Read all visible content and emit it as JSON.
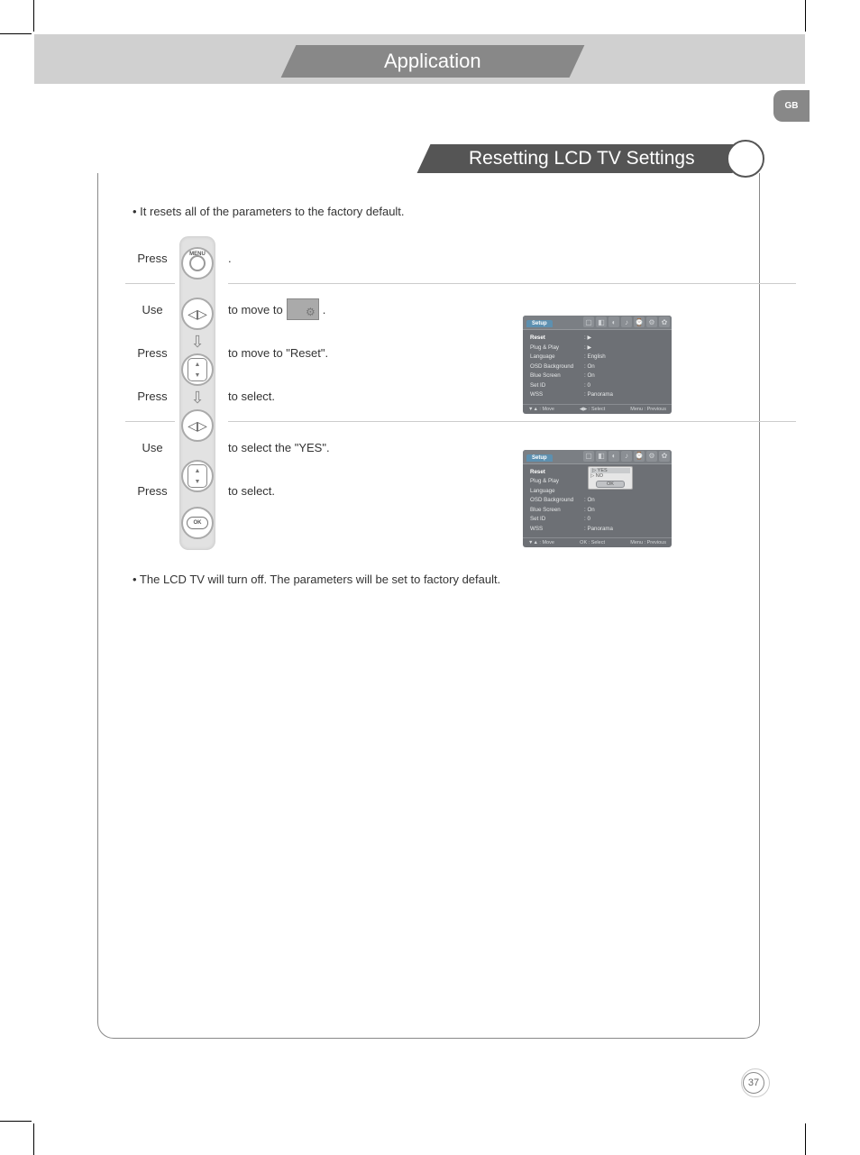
{
  "chapter_title": "Application",
  "language_tab": "GB",
  "section_title": "Resetting LCD TV Settings",
  "intro_bullet": "• It resets all of the parameters to the factory default.",
  "steps": [
    {
      "action": "Press",
      "icon": "menu-button-icon",
      "desc_prefix": "",
      "desc_suffix": "."
    },
    {
      "action": "Use",
      "icon": "left-right-button-icon",
      "desc_prefix": "to move to ",
      "desc_suffix": " ."
    },
    {
      "action": "Press",
      "icon": "down-arrow-button-icon",
      "desc_prefix": "to move to  \"Reset\".",
      "desc_suffix": ""
    },
    {
      "action": "Press",
      "icon": "left-right-button-icon",
      "desc_prefix": "to select.",
      "desc_suffix": ""
    },
    {
      "action": "Use",
      "icon": "up-down-button-icon",
      "desc_prefix": "to select the \"YES\".",
      "desc_suffix": ""
    },
    {
      "action": "Press",
      "icon": "ok-button-icon",
      "desc_prefix": "to select.",
      "desc_suffix": ""
    }
  ],
  "outro_bullet": "• The LCD TV will turn off. The parameters will be set to factory default.",
  "osd1": {
    "tab": "Setup",
    "rows": [
      {
        "label": "Reset",
        "value": ": ▶",
        "highlight": true
      },
      {
        "label": "Plug & Play",
        "value": ": ▶"
      },
      {
        "label": "Language",
        "value": ": English"
      },
      {
        "label": "OSD Background",
        "value": ": On"
      },
      {
        "label": "Blue Screen",
        "value": ": On"
      },
      {
        "label": "Set ID",
        "value": ": 0"
      },
      {
        "label": "WSS",
        "value": ": Panorama"
      }
    ],
    "footer": {
      "left": "▼▲ : Move",
      "mid": "◀▶ : Select",
      "right": "Menu : Previous"
    }
  },
  "osd2": {
    "tab": "Setup",
    "popup": {
      "opt1": "▷ YES",
      "opt2": "▷ NO",
      "ok": "OK"
    },
    "rows": [
      {
        "label": "Reset",
        "value": "",
        "highlight": true
      },
      {
        "label": "Plug & Play",
        "value": ""
      },
      {
        "label": "Language",
        "value": ""
      },
      {
        "label": "OSD Background",
        "value": ": On"
      },
      {
        "label": "Blue Screen",
        "value": ": On"
      },
      {
        "label": "Set ID",
        "value": ": 0"
      },
      {
        "label": "WSS",
        "value": ": Panorama"
      }
    ],
    "footer": {
      "left": "▼▲ : Move",
      "mid": "OK : Select",
      "right": "Menu : Previous"
    }
  },
  "page_number": "37"
}
